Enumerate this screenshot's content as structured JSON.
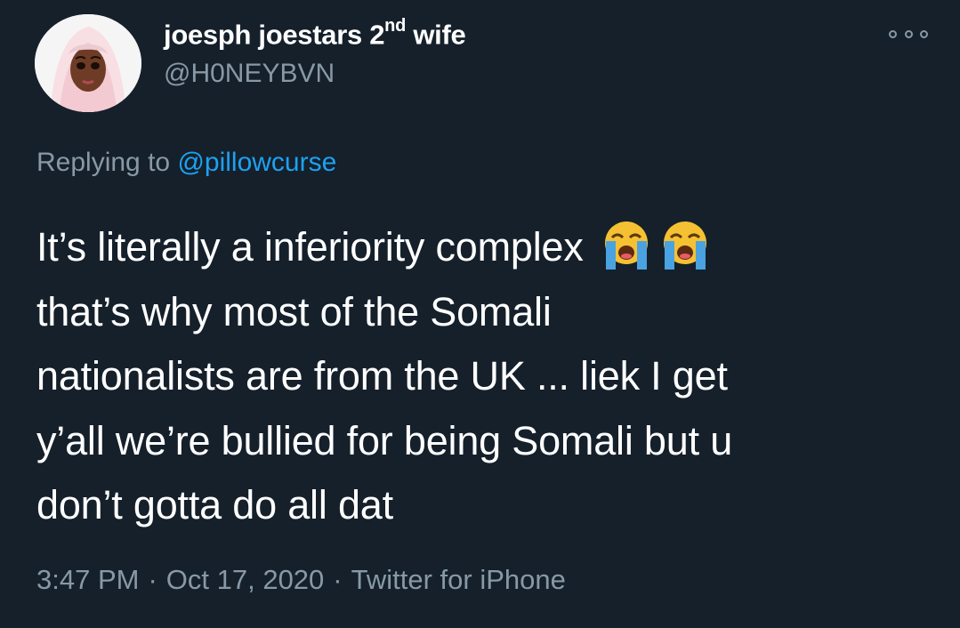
{
  "user": {
    "display_name": "joesph joestars 2",
    "display_name_sup": "nd",
    "display_name_end": " wife",
    "handle": "@H0NEYBVN",
    "avatar_icon": "avatar-woman-hijab"
  },
  "menu": {
    "icon": "more-options-icon"
  },
  "reply": {
    "prefix": "Replying to ",
    "mention": "@pillowcurse"
  },
  "tweet": {
    "lines": [
      "It’s literally a inferiority complex",
      "that’s why most of the Somali",
      "nationalists are from the UK ... liek I get",
      "y’all we’re bullied for being Somali but u",
      "don’t gotta do all dat"
    ],
    "emoji_icon": "loudly-crying-face-icon",
    "emoji_count": 2
  },
  "meta": {
    "time": "3:47 PM",
    "separator": "·",
    "date": "Oct 17, 2020",
    "source": "Twitter for iPhone"
  },
  "colors": {
    "background": "#15202b",
    "text": "#ffffff",
    "secondary": "#8899a6",
    "link": "#1da1f2"
  }
}
